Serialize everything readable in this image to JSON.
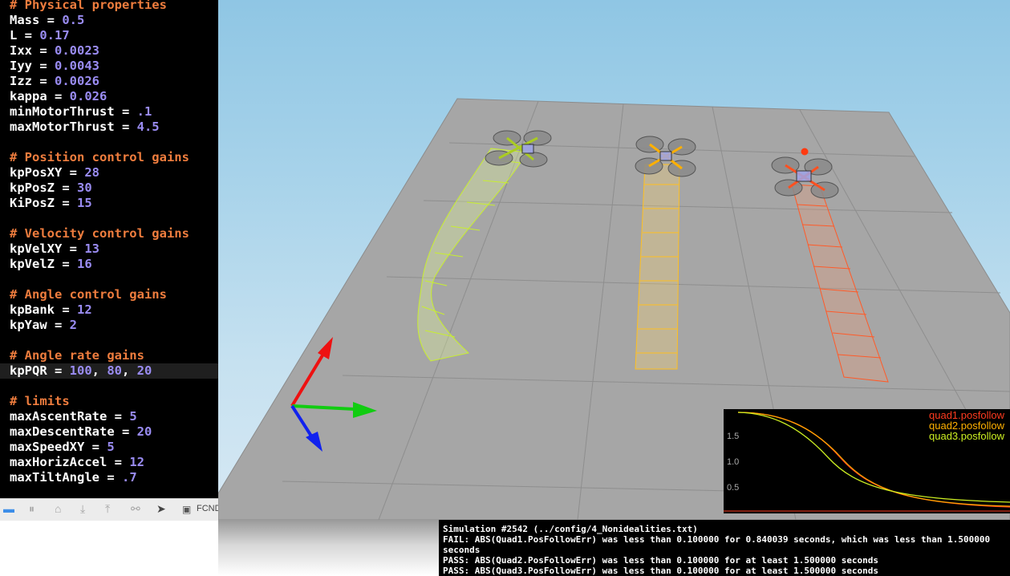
{
  "editor": {
    "lines": [
      {
        "parts": [
          {
            "t": "# Physical properties",
            "c": "cmt"
          }
        ]
      },
      {
        "parts": [
          {
            "t": "Mass = ",
            "c": ""
          },
          {
            "t": "0.5",
            "c": "num"
          }
        ]
      },
      {
        "parts": [
          {
            "t": "L = ",
            "c": ""
          },
          {
            "t": "0.17",
            "c": "num"
          }
        ]
      },
      {
        "parts": [
          {
            "t": "Ixx = ",
            "c": ""
          },
          {
            "t": "0.0023",
            "c": "num"
          }
        ]
      },
      {
        "parts": [
          {
            "t": "Iyy = ",
            "c": ""
          },
          {
            "t": "0.0043",
            "c": "num"
          }
        ]
      },
      {
        "parts": [
          {
            "t": "Izz = ",
            "c": ""
          },
          {
            "t": "0.0026",
            "c": "num"
          }
        ]
      },
      {
        "parts": [
          {
            "t": "kappa = ",
            "c": ""
          },
          {
            "t": "0.026",
            "c": "num"
          }
        ]
      },
      {
        "parts": [
          {
            "t": "minMotorThrust = ",
            "c": ""
          },
          {
            "t": ".1",
            "c": "num"
          }
        ]
      },
      {
        "parts": [
          {
            "t": "maxMotorThrust = ",
            "c": ""
          },
          {
            "t": "4.5",
            "c": "num"
          }
        ]
      },
      {
        "parts": []
      },
      {
        "parts": [
          {
            "t": "# Position control gains",
            "c": "cmt"
          }
        ]
      },
      {
        "parts": [
          {
            "t": "kpPosXY = ",
            "c": ""
          },
          {
            "t": "28",
            "c": "num"
          }
        ]
      },
      {
        "parts": [
          {
            "t": "kpPosZ = ",
            "c": ""
          },
          {
            "t": "30",
            "c": "num"
          }
        ]
      },
      {
        "parts": [
          {
            "t": "KiPosZ = ",
            "c": ""
          },
          {
            "t": "15",
            "c": "num"
          }
        ]
      },
      {
        "parts": []
      },
      {
        "parts": [
          {
            "t": "# Velocity control gains",
            "c": "cmt"
          }
        ]
      },
      {
        "parts": [
          {
            "t": "kpVelXY = ",
            "c": ""
          },
          {
            "t": "13",
            "c": "num"
          }
        ]
      },
      {
        "parts": [
          {
            "t": "kpVelZ = ",
            "c": ""
          },
          {
            "t": "16",
            "c": "num"
          }
        ]
      },
      {
        "parts": []
      },
      {
        "parts": [
          {
            "t": "# Angle control gains",
            "c": "cmt"
          }
        ]
      },
      {
        "parts": [
          {
            "t": "kpBank = ",
            "c": ""
          },
          {
            "t": "12",
            "c": "num"
          }
        ]
      },
      {
        "parts": [
          {
            "t": "kpYaw = ",
            "c": ""
          },
          {
            "t": "2",
            "c": "num"
          }
        ]
      },
      {
        "parts": []
      },
      {
        "parts": [
          {
            "t": "# Angle rate gains",
            "c": "cmt"
          }
        ]
      },
      {
        "parts": [
          {
            "t": "kpPQR = ",
            "c": ""
          },
          {
            "t": "100",
            "c": "num"
          },
          {
            "t": ", ",
            "c": ""
          },
          {
            "t": "80",
            "c": "num"
          },
          {
            "t": ", ",
            "c": ""
          },
          {
            "t": "20",
            "c": "num"
          }
        ],
        "current": true
      },
      {
        "parts": []
      },
      {
        "parts": [
          {
            "t": "# limits",
            "c": "cmt"
          }
        ]
      },
      {
        "parts": [
          {
            "t": "maxAscentRate = ",
            "c": ""
          },
          {
            "t": "5",
            "c": "num"
          }
        ]
      },
      {
        "parts": [
          {
            "t": "maxDescentRate = ",
            "c": ""
          },
          {
            "t": "20",
            "c": "num"
          }
        ]
      },
      {
        "parts": [
          {
            "t": "maxSpeedXY = ",
            "c": ""
          },
          {
            "t": "5",
            "c": "num"
          }
        ]
      },
      {
        "parts": [
          {
            "t": "maxHorizAccel = ",
            "c": ""
          },
          {
            "t": "12",
            "c": "num"
          }
        ]
      },
      {
        "parts": [
          {
            "t": "maxTiltAngle = ",
            "c": ""
          },
          {
            "t": ".7",
            "c": "num"
          }
        ]
      }
    ]
  },
  "toolbar": {
    "icons": [
      "breakpoint-icon",
      "pause-icon",
      "step-over-icon",
      "step-into-icon",
      "step-out-icon",
      "debug-graph-icon",
      "location-icon",
      "target-icon"
    ],
    "target_label": "FCND"
  },
  "plot": {
    "legend": [
      {
        "label": "quad1.posfollow",
        "color": "#ff3b1f"
      },
      {
        "label": "quad2.posfollow",
        "color": "#ffb000"
      },
      {
        "label": "quad3.posfollow",
        "color": "#ccee22"
      }
    ],
    "yticks": [
      "1.5",
      "1.0",
      "0.5"
    ]
  },
  "console": {
    "lines": [
      "Simulation #2542 (../config/4_Nonidealities.txt)",
      "FAIL: ABS(Quad1.PosFollowErr) was less than 0.100000 for 0.840039 seconds, which was less than 1.500000",
      "seconds",
      "PASS: ABS(Quad2.PosFollowErr) was less than 0.100000 for at least 1.500000 seconds",
      "PASS: ABS(Quad3.PosFollowErr) was less than 0.100000 for at least 1.500000 seconds"
    ]
  },
  "colors": {
    "comment": "#ef7d3e",
    "number": "#9a8cf2",
    "quad1": "#ff5020",
    "quad2": "#ffb800",
    "quad3": "#ccee22"
  }
}
